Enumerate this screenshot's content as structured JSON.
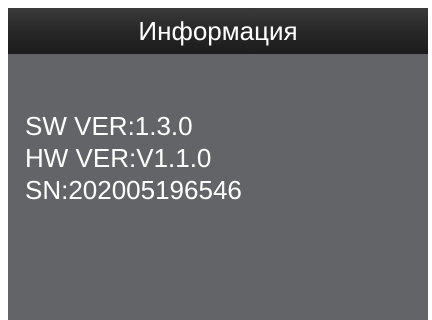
{
  "header": {
    "title": "Информация"
  },
  "info": {
    "sw_version": "SW VER:1.3.0",
    "hw_version": "HW VER:V1.1.0",
    "serial_number": "SN:202005196546"
  },
  "colors": {
    "screen_background": "#636467",
    "title_bar": "#262626",
    "text": "#ffffff"
  }
}
